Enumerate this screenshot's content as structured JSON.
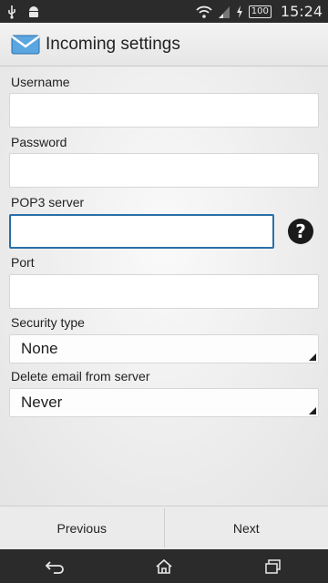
{
  "status_bar": {
    "battery": "100",
    "time": "15:24"
  },
  "action_bar": {
    "title": "Incoming settings"
  },
  "form": {
    "username_label": "Username",
    "username_value": "",
    "password_label": "Password",
    "password_value": "",
    "server_label": "POP3 server",
    "server_value": "",
    "help_glyph": "?",
    "port_label": "Port",
    "port_value": "",
    "security_label": "Security type",
    "security_value": "None",
    "delete_label": "Delete email from server",
    "delete_value": "Never"
  },
  "buttons": {
    "previous": "Previous",
    "next": "Next"
  },
  "colors": {
    "focus_border": "#2a6fa8",
    "status_bar_bg": "#2b2b2b"
  }
}
